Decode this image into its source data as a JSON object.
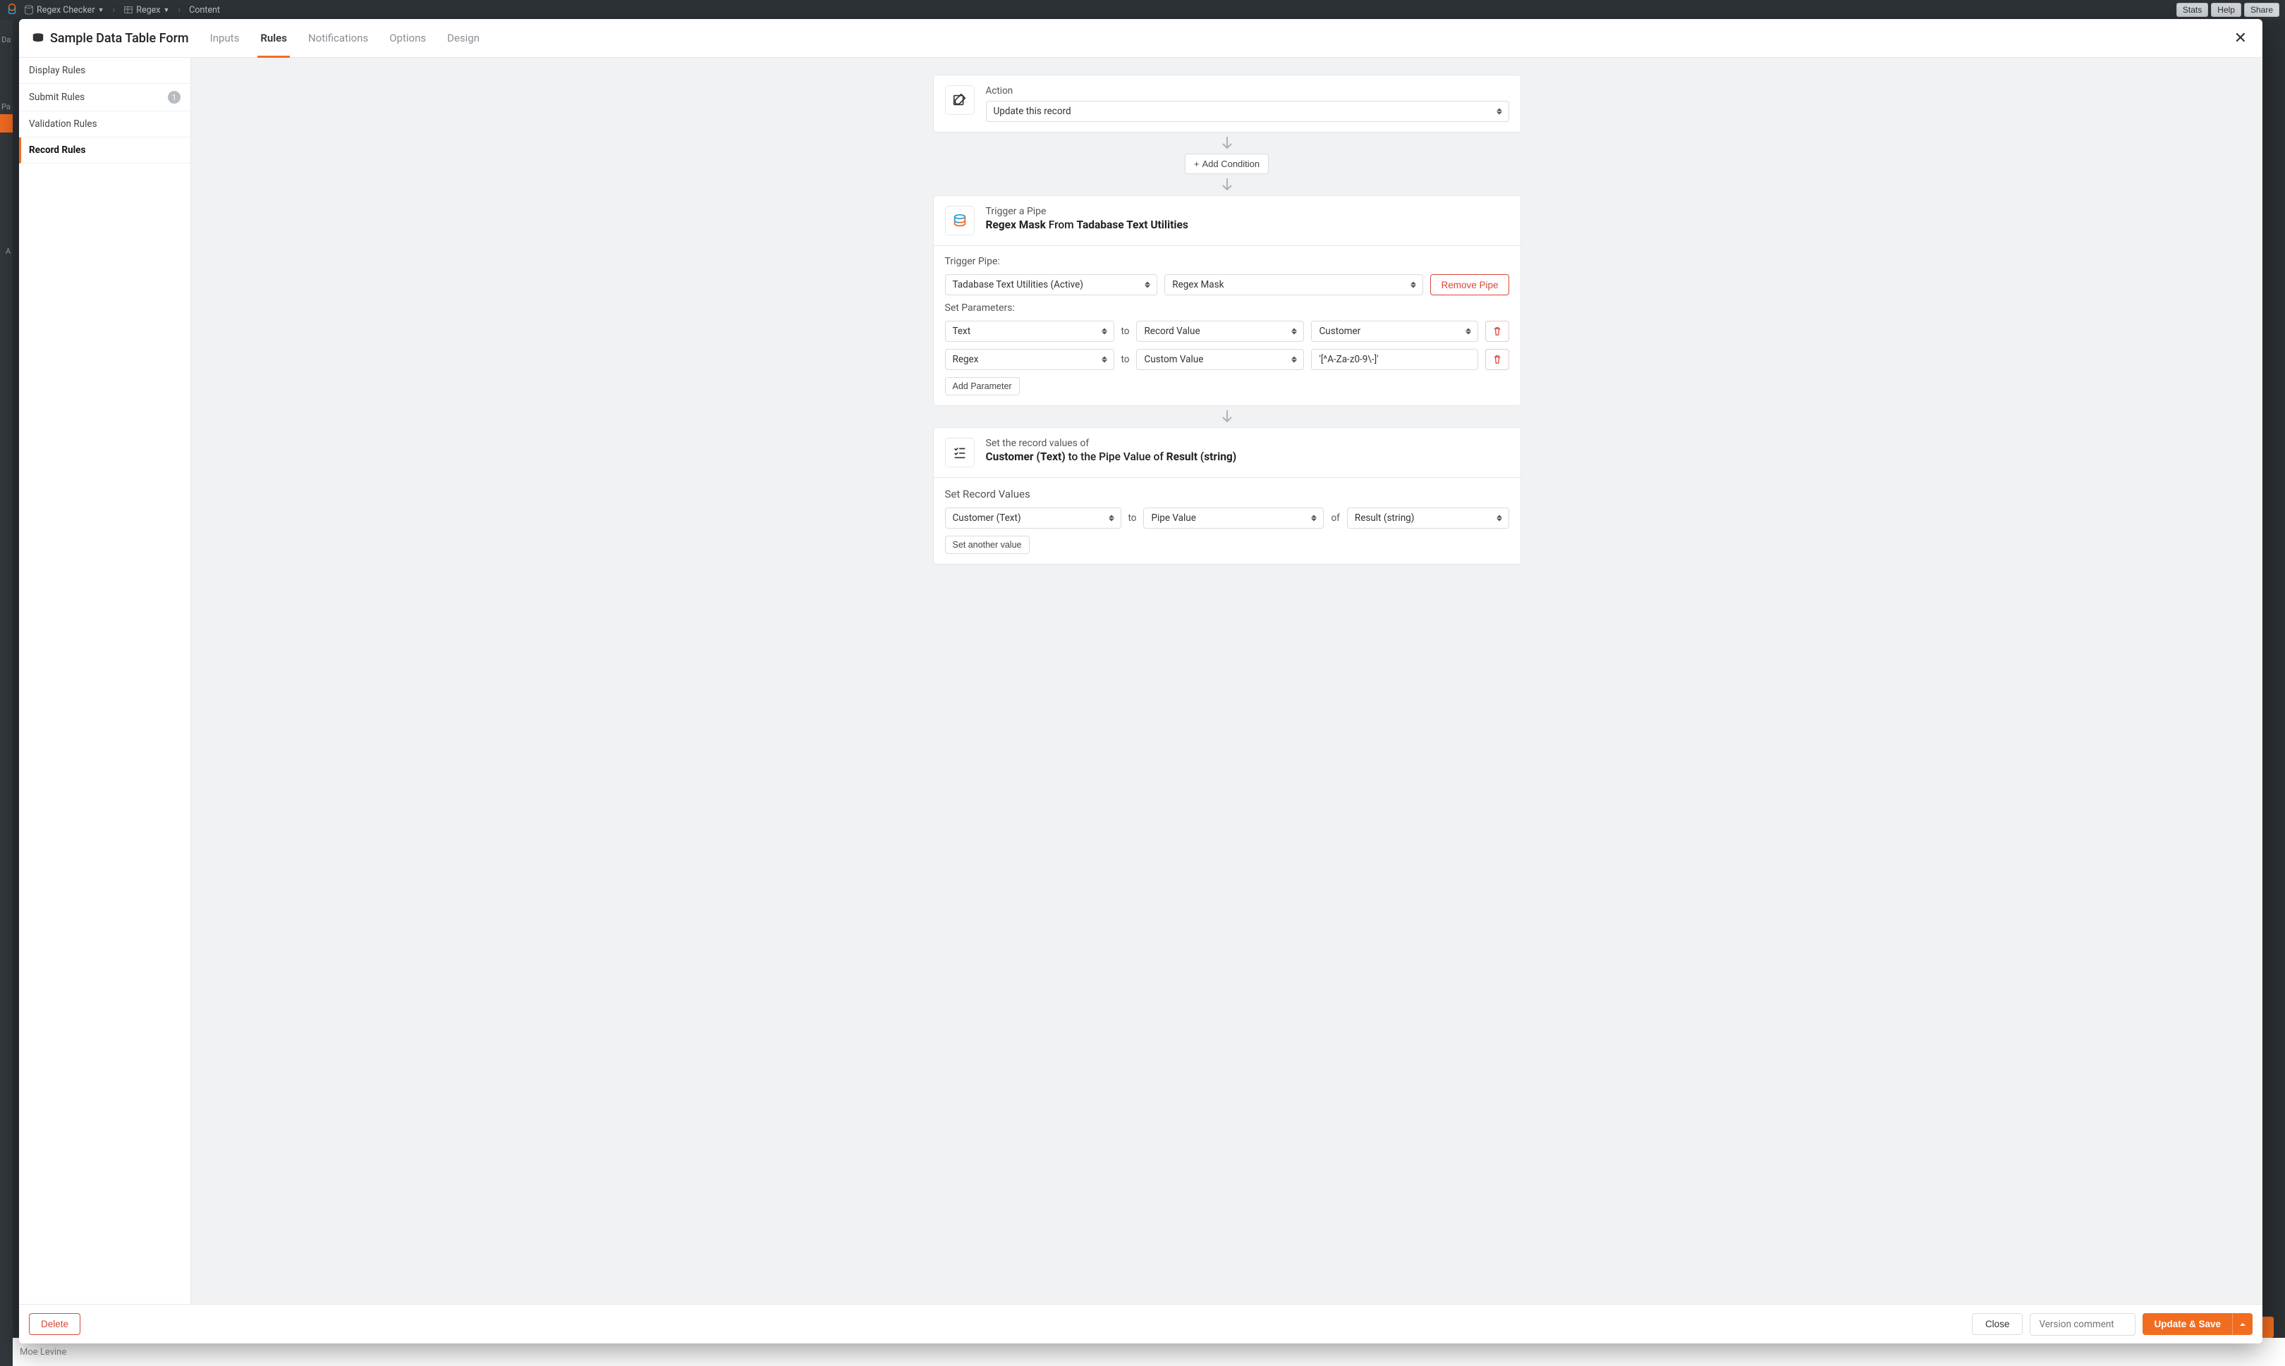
{
  "topbar": {
    "breadcrumb": {
      "db": "Regex Checker",
      "table": "Regex",
      "page": "Content"
    },
    "buttons": {
      "stats": "Stats",
      "help": "Help",
      "share": "Share"
    }
  },
  "background": {
    "left_labels": {
      "top": "Da",
      "mid": "Pa",
      "bot": "A"
    },
    "bottom_name": "Moe Levine"
  },
  "modal": {
    "title": "Sample Data Table Form",
    "tabs": {
      "inputs": "Inputs",
      "rules": "Rules",
      "notifications": "Notifications",
      "options": "Options",
      "design": "Design"
    }
  },
  "sidebar": {
    "display": "Display Rules",
    "submit": "Submit Rules",
    "submit_count": "1",
    "validation": "Validation Rules",
    "record": "Record Rules"
  },
  "rule": {
    "action_label": "Action",
    "action_value": "Update this record",
    "add_condition": "Add Condition",
    "pipe": {
      "head1": "Trigger a Pipe",
      "head2a": "Regex Mask",
      "head2b": " From ",
      "head2c": "Tadabase Text Utilities",
      "trigger_label": "Trigger Pipe:",
      "utility": "Tadabase Text Utilities (Active)",
      "mask": "Regex Mask",
      "remove": "Remove Pipe",
      "params_label": "Set Parameters:",
      "param1_key": "Text",
      "param1_type": "Record Value",
      "param1_val": "Customer",
      "param2_key": "Regex",
      "param2_type": "Custom Value",
      "param2_val": "'[^A-Za-z0-9\\-]'",
      "add_param": "Add Parameter",
      "to": "to"
    },
    "setvals": {
      "head1": "Set the record values of",
      "head2a": "Customer (Text)",
      "head2b": " to the Pipe Value of ",
      "head2c": "Result (string)",
      "label": "Set Record Values",
      "field": "Customer (Text)",
      "to": "to",
      "type": "Pipe Value",
      "of": "of",
      "result": "Result (string)",
      "add": "Set another value"
    }
  },
  "footer": {
    "delete": "Delete",
    "close": "Close",
    "version_placeholder": "Version comment",
    "save": "Update & Save"
  }
}
